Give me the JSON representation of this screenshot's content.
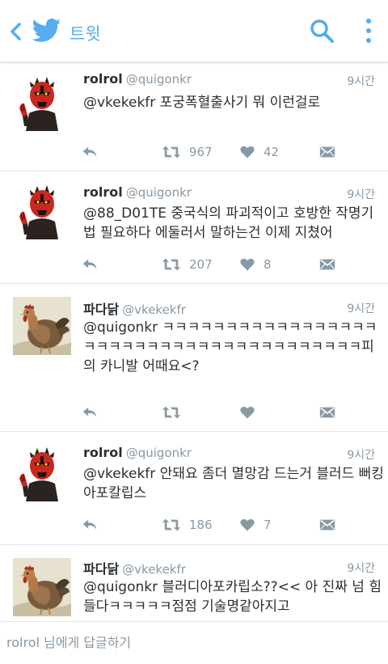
{
  "header": {
    "title": "트윗"
  },
  "tweets": [
    {
      "name": "rolrol",
      "handle": "@quigonkr",
      "time": "9시간",
      "text": "@vkekekfr 포궁폭혈출사기 뭐 이런걸로",
      "retweets": "967",
      "likes": "42",
      "avatar": "sith-avatar"
    },
    {
      "name": "rolrol",
      "handle": "@quigonkr",
      "time": "9시간",
      "text": "@88_D01TE 중국식의 파괴적이고 호방한 작명기법 필요하다 에둘러서 말하는건 이제 지쳤어",
      "retweets": "207",
      "likes": "8",
      "avatar": "sith-avatar"
    },
    {
      "name": "파다닭",
      "handle": "@vkekekfr",
      "time": "9시간",
      "text": "@quigonkr ㅋㅋㅋㅋㅋㅋㅋㅋㅋㅋㅋㅋㅋㅋㅋㅋㅋㅋㅋㅋㅋㅋㅋㅋㅋㅋㅋㅋㅋㅋㅋㅋㅋㅋㅋㅋㅋㅋㅋ피의 카니발 어때요<?",
      "retweets": "",
      "likes": "",
      "avatar": "rooster-avatar"
    },
    {
      "name": "rolrol",
      "handle": "@quigonkr",
      "time": "9시간",
      "text": "@vkekekfr 안돼요 좀더 멸망감 드는거 블러드 뻐킹 아포칼립스",
      "retweets": "186",
      "likes": "7",
      "avatar": "sith-avatar"
    },
    {
      "name": "파다닭",
      "handle": "@vkekekfr",
      "time": "9시간",
      "text": "@quigonkr 블러디아포카립소??<< 아 진짜 넘 힘들다ㅋㅋㅋㅋㅋ점점 기술명같아지고",
      "retweets": "",
      "likes": "",
      "avatar": "rooster-avatar"
    }
  ],
  "reply": {
    "placeholder": "rolrol 님에게 답글하기"
  },
  "colors": {
    "twitter_blue": "#55acee",
    "icon_gray": "#8899a6",
    "divider": "#e1e8ed"
  }
}
